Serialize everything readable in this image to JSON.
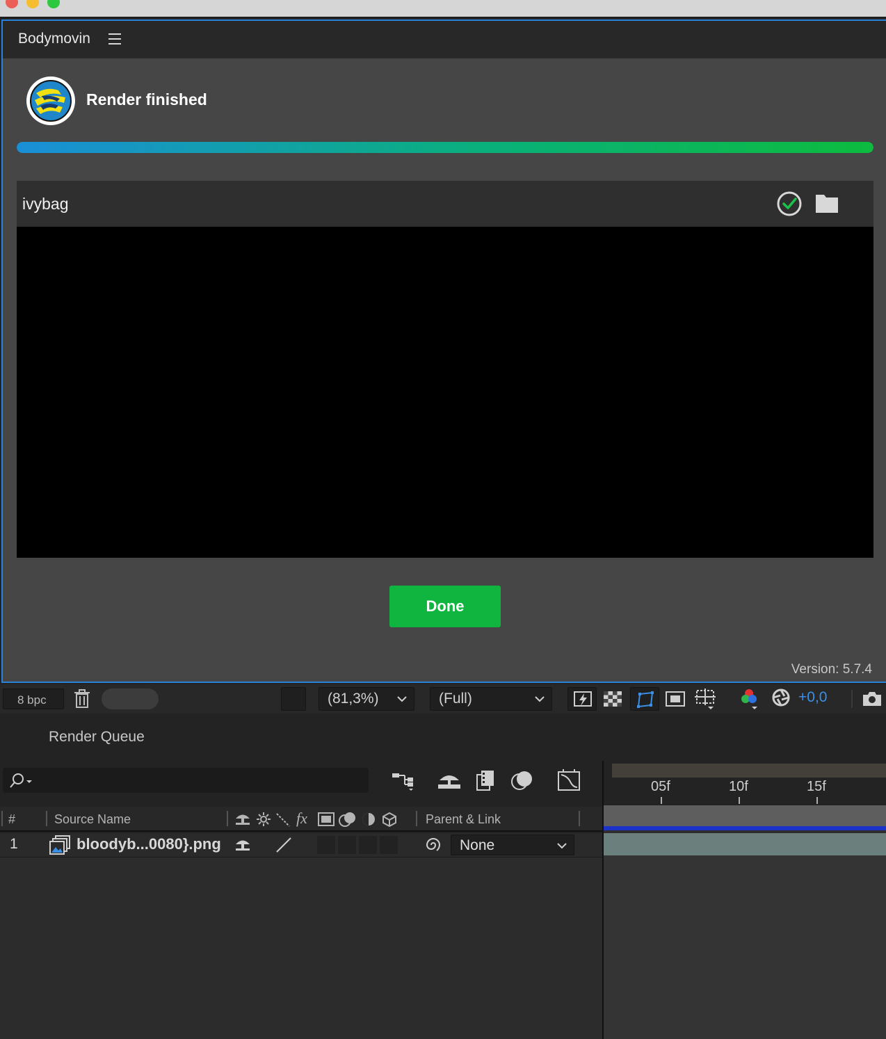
{
  "bodymovin": {
    "panel_title": "Bodymovin",
    "status_title": "Render finished",
    "progress_percent": 100,
    "file_name": "ivybag",
    "done_label": "Done",
    "version": "Version: 5.7.4"
  },
  "viewer_toolbar": {
    "bpc": "8 bpc",
    "zoom": "(81,3%)",
    "resolution": "(Full)",
    "exposure": "+0,0"
  },
  "render_queue": {
    "tab_label": "Render Queue",
    "columns": {
      "number": "#",
      "source_name": "Source Name",
      "fx": "fx",
      "parent_link": "Parent & Link"
    },
    "layers": [
      {
        "number": "1",
        "source_name": "bloodyb...0080}.png",
        "parent": "None"
      }
    ],
    "timeline_ticks": [
      "05f",
      "10f",
      "15f"
    ]
  },
  "colors": {
    "accent_blue": "#2a83d8",
    "done_green": "#0fb53f",
    "progress_start": "#1a8fd8",
    "progress_end": "#0cbb3f",
    "exposure_blue": "#3b8fe6"
  },
  "icons": [
    "menu-icon",
    "bodymovin-logo",
    "check-circle-icon",
    "folder-icon",
    "trash-icon",
    "search-icon",
    "camera-icon"
  ]
}
